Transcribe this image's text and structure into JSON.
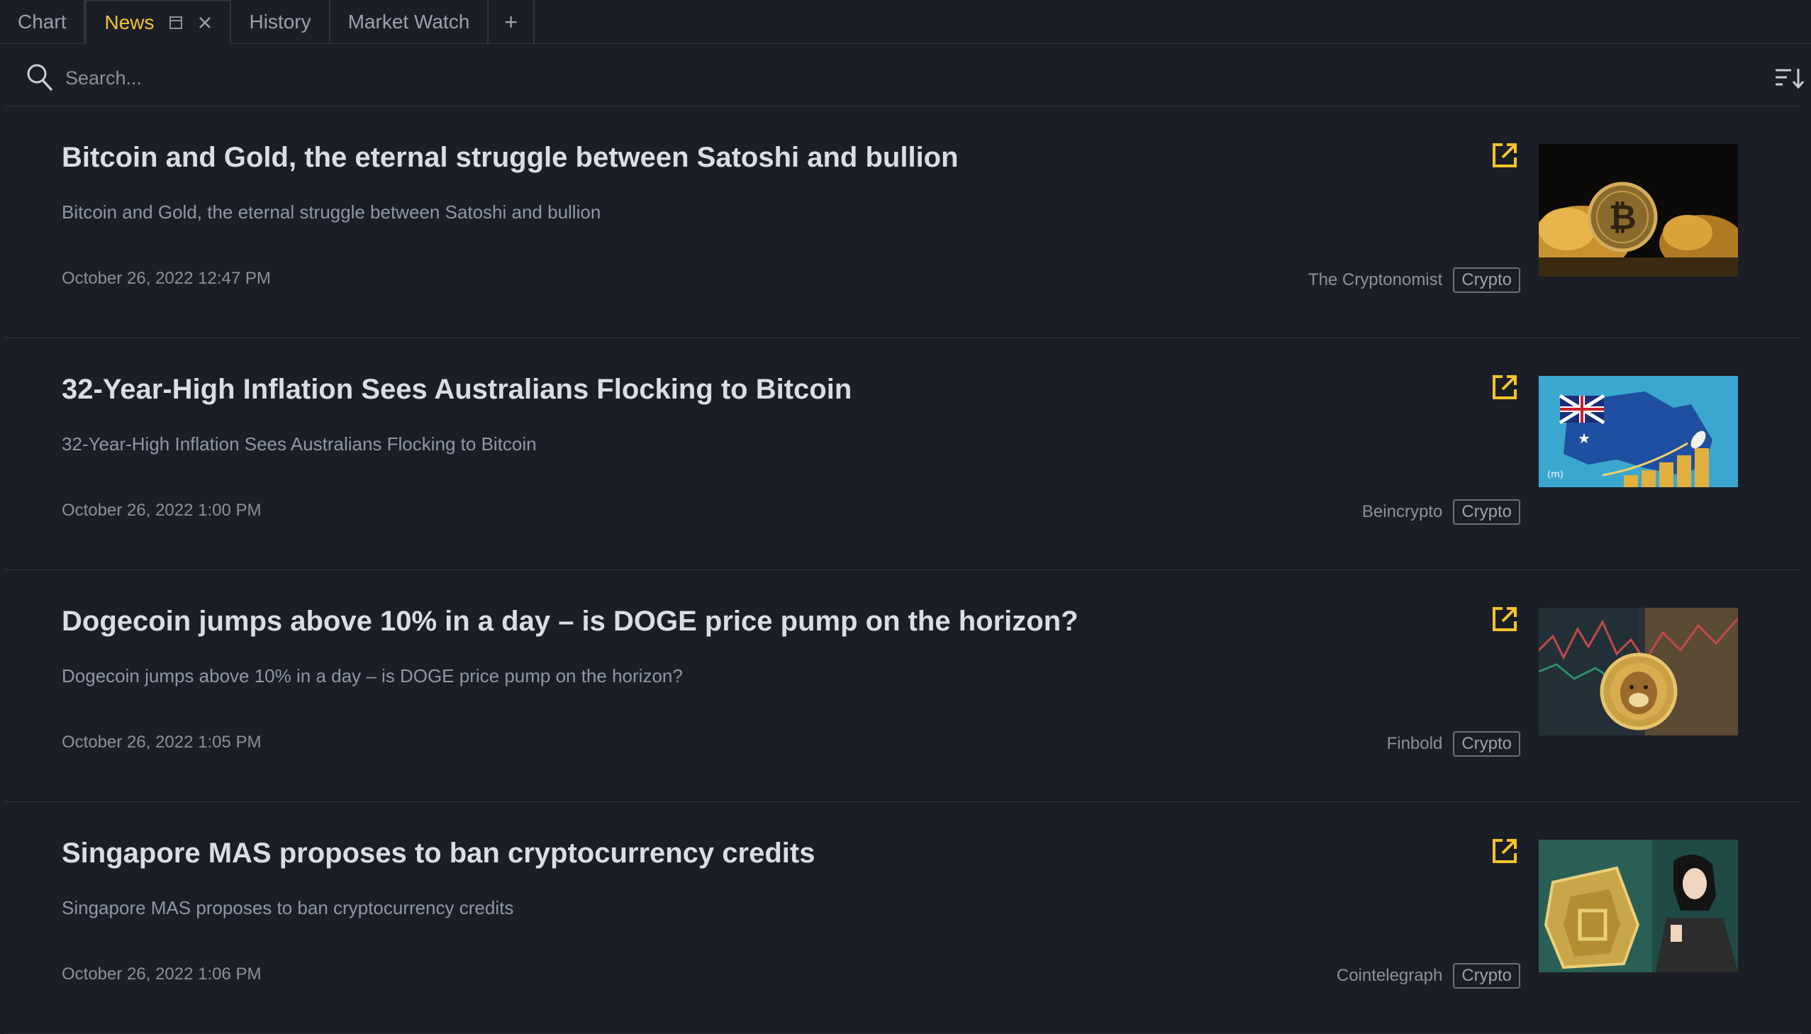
{
  "tabs": [
    {
      "label": "Chart"
    },
    {
      "label": "News"
    },
    {
      "label": "History"
    },
    {
      "label": "Market Watch"
    }
  ],
  "add_tab_label": "+",
  "search": {
    "placeholder": "Search...",
    "value": ""
  },
  "colors": {
    "accent": "#f5c32c",
    "background": "#1b1e27",
    "divider": "#30343f"
  },
  "icons": {
    "search": "search-icon",
    "sort": "sort-descending-icon",
    "external": "external-link-icon",
    "popout": "popout-icon",
    "close": "close-icon"
  },
  "news": [
    {
      "title": "Bitcoin and Gold, the eternal struggle between Satoshi and bullion",
      "summary": "Bitcoin and Gold, the eternal struggle between Satoshi and bullion",
      "date": "October 26, 2022 12:47 PM",
      "source": "The Cryptonomist",
      "tag": "Crypto"
    },
    {
      "title": "32-Year-High Inflation Sees Australians Flocking to Bitcoin",
      "summary": "32-Year-High Inflation Sees Australians Flocking to Bitcoin",
      "date": "October 26, 2022 1:00 PM",
      "source": "Beincrypto",
      "tag": "Crypto"
    },
    {
      "title": "Dogecoin jumps above 10% in a day – is DOGE price pump on the horizon?",
      "summary": "Dogecoin jumps above 10% in a day – is DOGE price pump on the horizon?",
      "date": "October 26, 2022 1:05 PM",
      "source": "Finbold",
      "tag": "Crypto"
    },
    {
      "title": "Singapore MAS proposes to ban cryptocurrency credits",
      "summary": "Singapore MAS proposes to ban cryptocurrency credits",
      "date": "October 26, 2022 1:06 PM",
      "source": "Cointelegraph",
      "tag": "Crypto"
    }
  ]
}
